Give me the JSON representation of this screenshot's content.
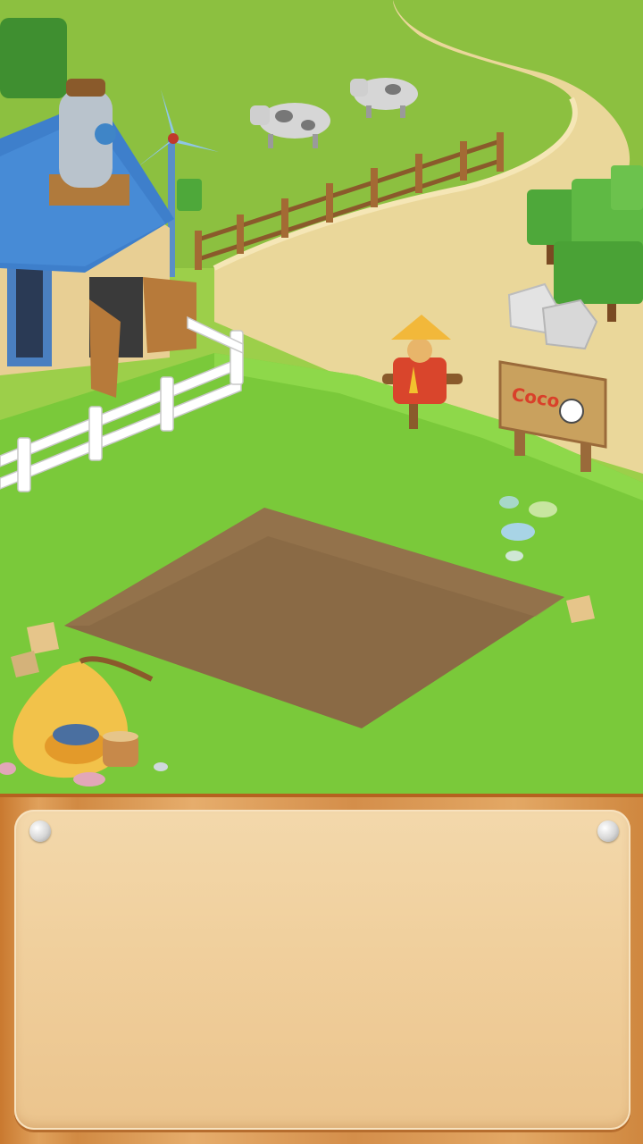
{
  "scene": {
    "sign_logo_text": "Coco"
  },
  "panel": {
    "style": "wooden board",
    "pins": 2
  },
  "colors": {
    "grass": "#7ac93a",
    "soil": "#8a6a45",
    "path": "#ead79a",
    "board": "#f0cf9c",
    "frame": "#d18a43",
    "roof": "#3e7fcb"
  }
}
